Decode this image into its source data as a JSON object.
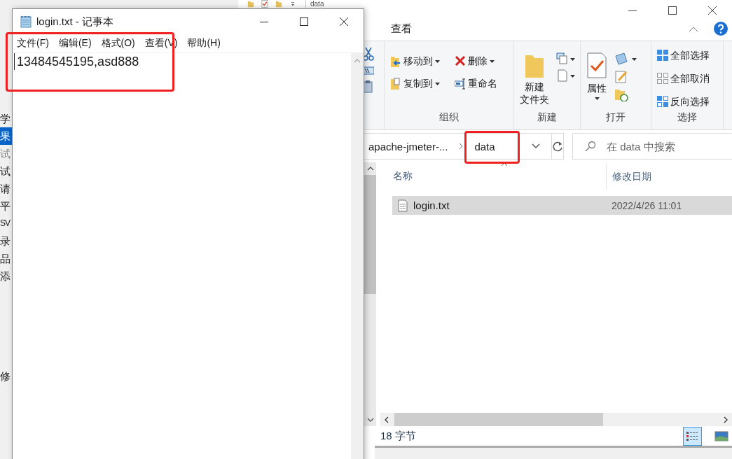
{
  "background_app": {
    "tree_items": [
      {
        "label": "学",
        "selected": false,
        "disabled": false
      },
      {
        "label": "果",
        "selected": true,
        "disabled": false
      },
      {
        "label": "试",
        "selected": false,
        "disabled": true
      },
      {
        "label": "试",
        "selected": false,
        "disabled": false
      },
      {
        "label": "请",
        "selected": false,
        "disabled": false
      },
      {
        "label": "平",
        "selected": false,
        "disabled": false
      },
      {
        "label": "SV",
        "selected": false,
        "disabled": false
      },
      {
        "label": "录",
        "selected": false,
        "disabled": false
      },
      {
        "label": "品",
        "selected": false,
        "disabled": false
      },
      {
        "label": "添",
        "selected": false,
        "disabled": false
      }
    ],
    "field_label": "修"
  },
  "explorer": {
    "title": "data",
    "tabs": [
      {
        "label": "查看",
        "selected": false
      }
    ],
    "ribbon_groups": [
      {
        "label": "组织",
        "buttons": [
          {
            "label": "移动到",
            "kind": "move"
          },
          {
            "label": "删除",
            "kind": "delete"
          },
          {
            "label": "复制到",
            "kind": "copy"
          },
          {
            "label": "重命名",
            "kind": "rename"
          }
        ]
      },
      {
        "label": "新建",
        "buttons": [
          {
            "lines": [
              "新建",
              "文件夹"
            ],
            "kind": "folder"
          }
        ]
      },
      {
        "label": "打开",
        "buttons": [
          {
            "label": "属性",
            "kind": "properties"
          }
        ]
      },
      {
        "label": "选择",
        "buttons": [
          {
            "label": "全部选择",
            "kind": "selectall"
          },
          {
            "label": "全部取消",
            "kind": "selectnone"
          },
          {
            "label": "反向选择",
            "kind": "invert"
          }
        ]
      }
    ],
    "breadcrumb": [
      "apache-jmeter-...",
      "data"
    ],
    "search": {
      "placeholder": "在 data 中搜索"
    },
    "columns": [
      "名称",
      "修改日期"
    ],
    "rows": [
      {
        "name": "login.txt",
        "modified": "2022/4/26 11:01",
        "selected": true
      }
    ],
    "status_bar": [
      "18 字节"
    ],
    "views": [
      {
        "kind": "details",
        "selected": true
      },
      {
        "kind": "large",
        "selected": false
      }
    ]
  },
  "notepad": {
    "title": "login.txt - 记事本",
    "menu": [
      "文件(F)",
      "编辑(E)",
      "格式(O)",
      "查看(V)",
      "帮助(H)"
    ],
    "content": "13484545195,asd888"
  }
}
